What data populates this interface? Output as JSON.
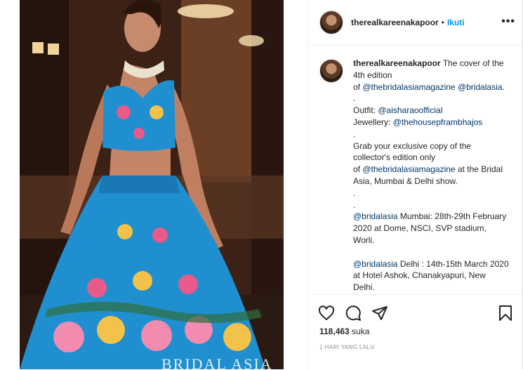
{
  "post": {
    "author": "therealkareenakapoor",
    "header_dot": "•",
    "follow_label": "Ikuti",
    "more_label": "•••",
    "photo_watermark": "BRIDAL ASIA"
  },
  "caption": {
    "username": "therealkareenakapoor",
    "lines": [
      {
        "pre": " The cover of the 4th edition",
        "tag": "",
        "post": ""
      },
      {
        "pre": "of ",
        "tag": "@thebridalasiamagazine",
        "post": ""
      },
      {
        "pre": "",
        "tag": "@bridalasia",
        "post": ". ."
      },
      {
        "pre": "Outfit: ",
        "tag": "@aisharaoofficial",
        "post": ""
      },
      {
        "pre": "Jewellery: ",
        "tag": "@thehousepframbhajos",
        "post": ""
      },
      {
        "pre": ".",
        "tag": "",
        "post": ""
      },
      {
        "pre": "Grab your exclusive copy of the collector's edition only",
        "tag": "",
        "post": ""
      },
      {
        "pre": "of ",
        "tag": "@thebridalasiamagazine",
        "post": " at the Bridal Asia, Mumbai & Delhi show."
      },
      {
        "pre": ".",
        "tag": "",
        "post": ""
      },
      {
        "pre": ".",
        "tag": "",
        "post": ""
      },
      {
        "pre": "",
        "tag": "@bridalasia",
        "post": " Mumbai: 28th-29th February 2020 at Dome, NSCI, SVP stadium, Worli."
      },
      {
        "pre": "",
        "tag": "",
        "post": ""
      },
      {
        "pre": "",
        "tag": "@bridalasia",
        "post": " Delhi : 14th-15th March 2020 at Hotel Ashok, Chanakyapuri, New Delhi."
      }
    ]
  },
  "actions": {
    "like_icon": "heart-icon",
    "comment_icon": "comment-icon",
    "share_icon": "share-icon",
    "save_icon": "bookmark-icon"
  },
  "likes": {
    "count": "118,463",
    "suffix": " suka"
  },
  "timestamp": "1 HARI YANG LALU",
  "colors": {
    "link_blue": "#0095f6",
    "mention_blue": "#00376b",
    "text": "#262626",
    "muted": "#8e8e8e",
    "border": "#efefef",
    "dress_blue": "#1f8fd0"
  }
}
